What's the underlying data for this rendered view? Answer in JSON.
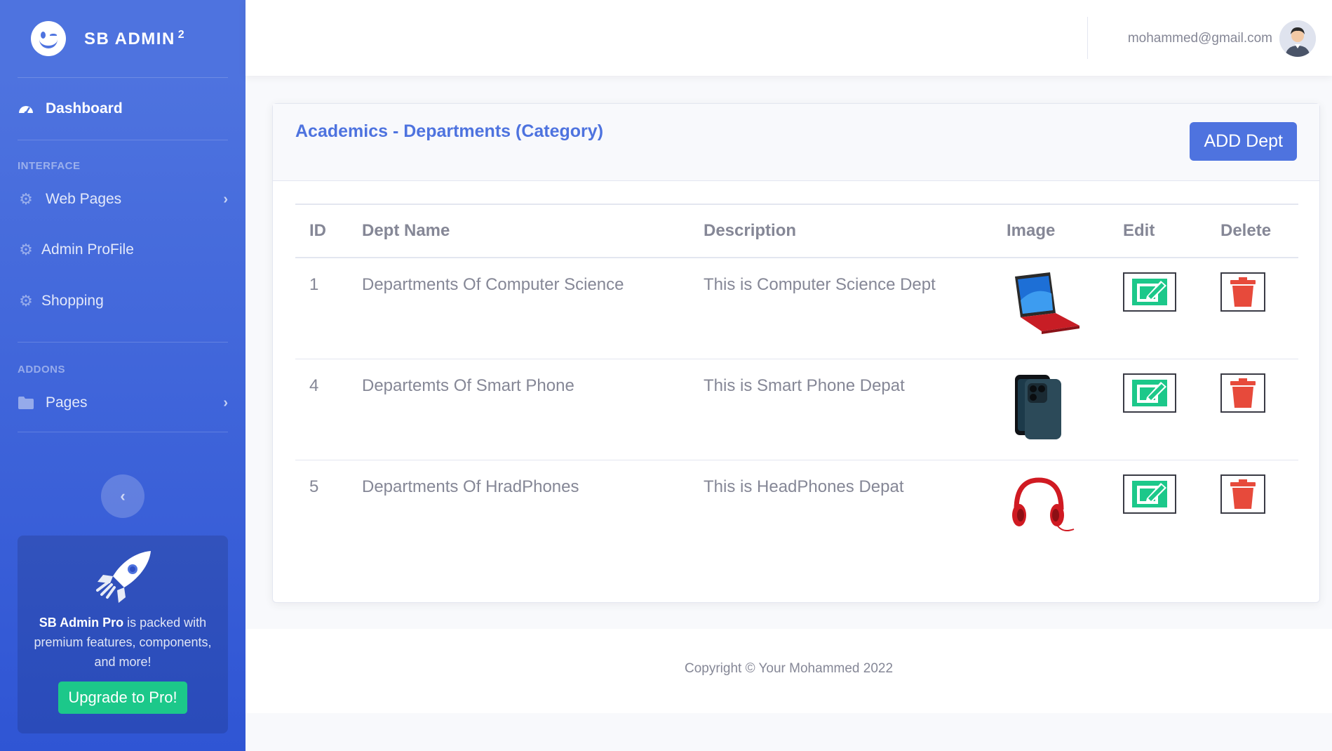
{
  "sidebar": {
    "brand": "SB ADMIN",
    "brand_sup": "2",
    "dashboard": "Dashboard",
    "heading_interface": "INTERFACE",
    "web_pages": "Web Pages",
    "admin_profile": "Admin ProFile",
    "shopping": "Shopping",
    "heading_addons": "ADDONS",
    "pages": "Pages",
    "promo_bold": "SB Admin Pro",
    "promo_text": " is packed with premium features, components, and more!",
    "promo_button": "Upgrade to Pro!"
  },
  "topbar": {
    "email": "mohammed@gmail.com"
  },
  "card": {
    "title": "Academics - Departments (Category)",
    "add_button": "ADD Dept",
    "columns": [
      "ID",
      "Dept Name",
      "Description",
      "Image",
      "Edit",
      "Delete"
    ],
    "rows": [
      {
        "id": "1",
        "name": "Departments Of Computer Science",
        "description": "This is Computer Science Dept",
        "image": "laptop-image"
      },
      {
        "id": "4",
        "name": "Departemts Of Smart Phone",
        "description": "This is Smart Phone Depat",
        "image": "smartphone-image"
      },
      {
        "id": "5",
        "name": "Departments Of HradPhones",
        "description": "This is HeadPhones Depat",
        "image": "headphones-image"
      }
    ]
  },
  "footer": {
    "copyright": "Copyright © Your Mohammed 2022"
  },
  "colors": {
    "primary": "#4e73df",
    "success": "#1cc88a",
    "danger": "#e74a3b"
  }
}
